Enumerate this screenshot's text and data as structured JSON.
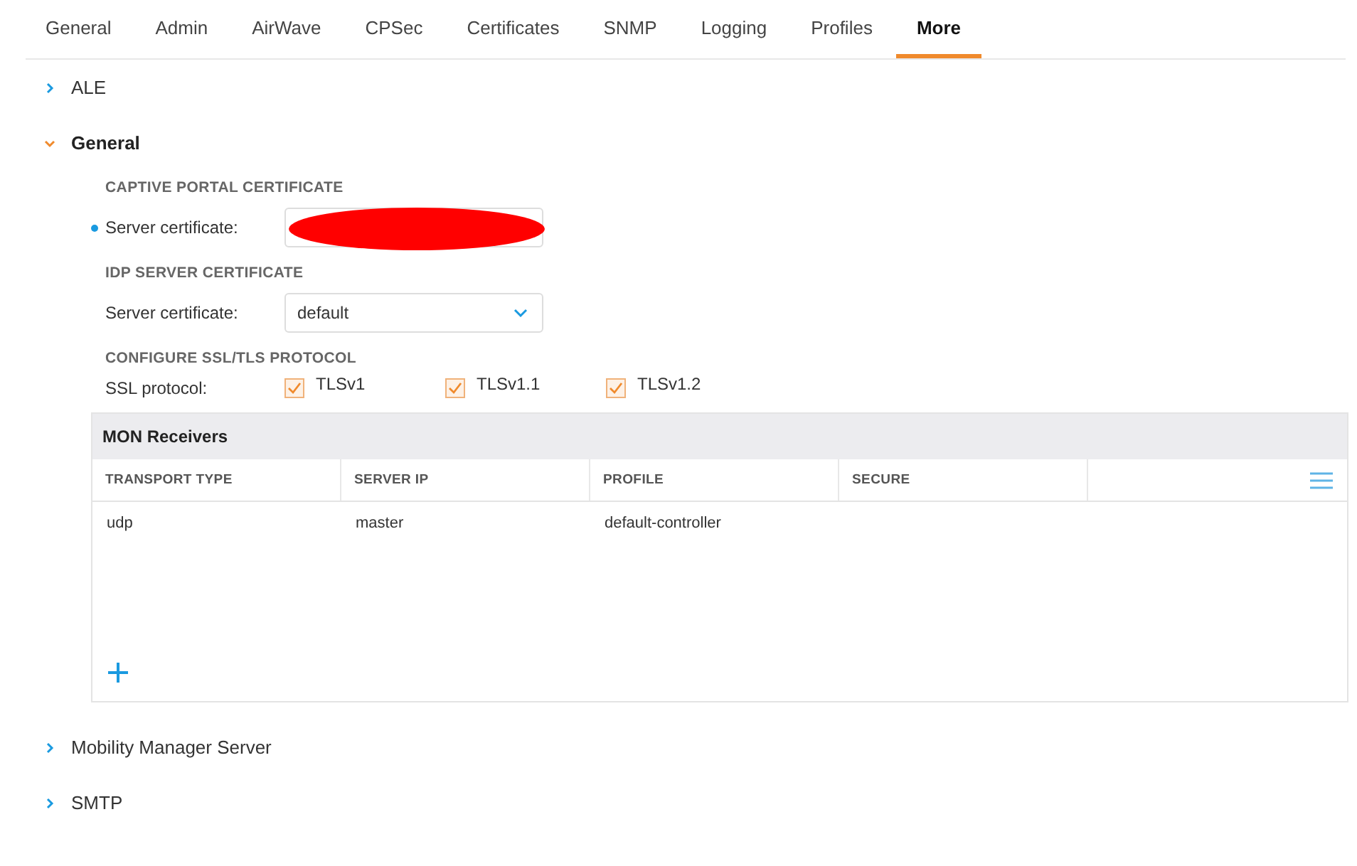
{
  "tabs": [
    {
      "label": "General",
      "selected": false
    },
    {
      "label": "Admin",
      "selected": false
    },
    {
      "label": "AirWave",
      "selected": false
    },
    {
      "label": "CPSec",
      "selected": false
    },
    {
      "label": "Certificates",
      "selected": false
    },
    {
      "label": "SNMP",
      "selected": false
    },
    {
      "label": "Logging",
      "selected": false
    },
    {
      "label": "Profiles",
      "selected": false
    },
    {
      "label": "More",
      "selected": true
    }
  ],
  "sections": [
    {
      "title": "ALE",
      "expanded": false
    },
    {
      "title": "General",
      "expanded": true,
      "content": {
        "captive_portal": {
          "heading": "CAPTIVE PORTAL CERTIFICATE",
          "label": "Server certificate:",
          "required": true
        },
        "idp": {
          "heading": "IDP SERVER CERTIFICATE",
          "label": "Server certificate:",
          "value": "default"
        },
        "ssl": {
          "heading": "CONFIGURE SSL/TLS PROTOCOL",
          "label": "SSL protocol:",
          "options": [
            {
              "label": "TLSv1",
              "checked": true
            },
            {
              "label": "TLSv1.1",
              "checked": true
            },
            {
              "label": "TLSv1.2",
              "checked": true
            }
          ]
        },
        "table": {
          "title": "MON Receivers",
          "columns": [
            "TRANSPORT TYPE",
            "SERVER IP",
            "PROFILE",
            "SECURE"
          ],
          "rows": [
            [
              "udp",
              "master",
              "default-controller",
              ""
            ]
          ]
        }
      }
    },
    {
      "title": "Mobility Manager Server",
      "expanded": false
    },
    {
      "title": "SMTP",
      "expanded": false
    }
  ]
}
